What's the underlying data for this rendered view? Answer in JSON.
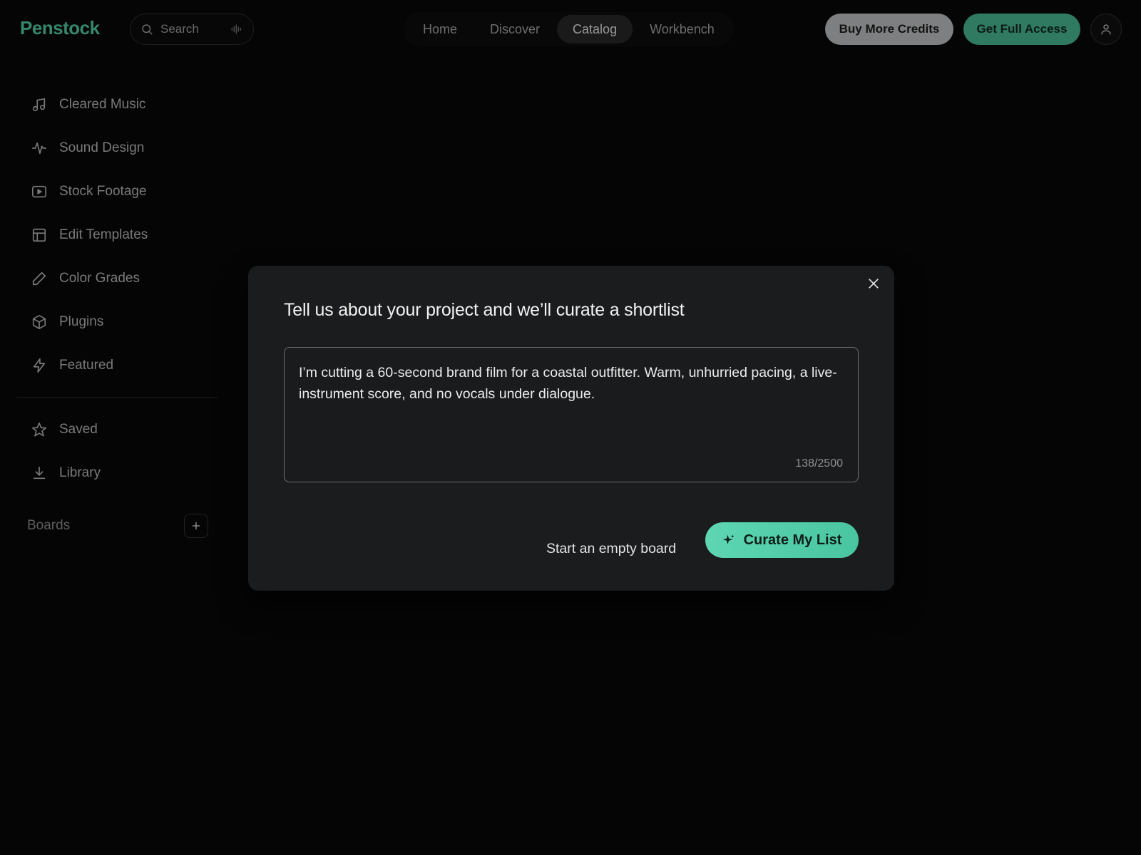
{
  "app": {
    "logo": "Penstock"
  },
  "search": {
    "placeholder": "Search"
  },
  "nav": {
    "tabs": [
      {
        "label": "Home"
      },
      {
        "label": "Discover"
      },
      {
        "label": "Catalog"
      },
      {
        "label": "Workbench"
      }
    ],
    "active": "Catalog"
  },
  "header": {
    "buy_credits_label": "Buy More Credits",
    "full_access_label": "Get Full Access"
  },
  "sidebar": {
    "items": [
      {
        "label": "Cleared Music",
        "icon": "music-note-icon"
      },
      {
        "label": "Sound Design",
        "icon": "waveform-icon"
      },
      {
        "label": "Stock Footage",
        "icon": "video-play-icon"
      },
      {
        "label": "Edit Templates",
        "icon": "layout-template-icon"
      },
      {
        "label": "Color Grades",
        "icon": "pencil-icon"
      },
      {
        "label": "Plugins",
        "icon": "cube-icon"
      },
      {
        "label": "Featured",
        "icon": "lightning-icon"
      }
    ],
    "secondary_items": [
      {
        "label": "Saved",
        "icon": "star-icon"
      },
      {
        "label": "Library",
        "icon": "download-icon"
      }
    ],
    "boards_label": "Boards"
  },
  "modal": {
    "title": "Tell us about your project and we’ll curate a shortlist",
    "textarea_value": "I’m cutting a 60-second brand film for a coastal outfitter. Warm, unhurried pacing, a live-instrument score, and no vocals under dialogue.",
    "char_count": "138/2500",
    "secondary_label": "Start an empty board",
    "primary_label": "Curate My List"
  },
  "colors": {
    "brand_green": "#3f9e7d",
    "accent_mint": "#5ed6b3",
    "modal_bg": "#1a1c1d",
    "page_bg": "#050505"
  }
}
